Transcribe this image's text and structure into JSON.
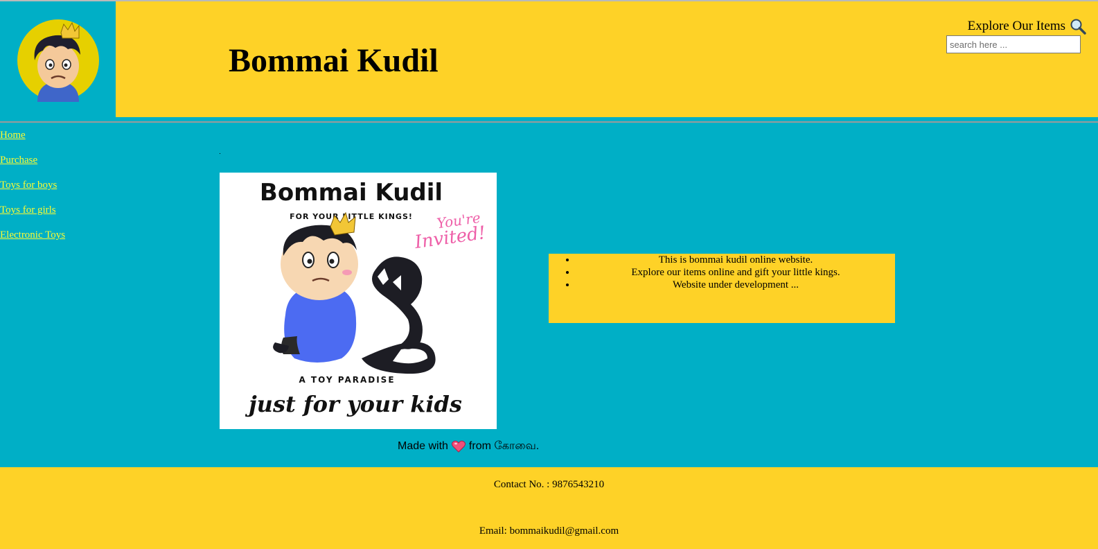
{
  "header": {
    "title": "Bommai Kudil",
    "explore_label": "Explore Our Items",
    "search_placeholder": "search here ...",
    "search_value": ""
  },
  "nav": {
    "items": [
      {
        "label": "Home"
      },
      {
        "label": "Purchase"
      },
      {
        "label": "Toys for boys"
      },
      {
        "label": "Toys for girls"
      },
      {
        "label": "Electronic Toys"
      }
    ]
  },
  "poster": {
    "title": "Bommai Kudil",
    "tagline": "FOR YOUR LITTLE KINGS!",
    "invite_line1": "You're",
    "invite_line2": "Invited!",
    "subtitle": "A TOY PARADISE",
    "slogan": "just for your kids"
  },
  "info": {
    "items": [
      "This is bommai kudil online website.",
      "Explore our items online and gift your little kings.",
      "Website under development ..."
    ]
  },
  "made_with": {
    "prefix": "Made with",
    "suffix": "from கோவை."
  },
  "footer": {
    "phone": "Contact No. : 9876543210",
    "email": "Email: bommaikudil@gmail.com"
  },
  "colors": {
    "yellow": "#fed227",
    "teal": "#00afc6",
    "link": "#fbfb33"
  },
  "icons": [
    "search-icon",
    "heart-icon",
    "logo-avatar-icon"
  ]
}
